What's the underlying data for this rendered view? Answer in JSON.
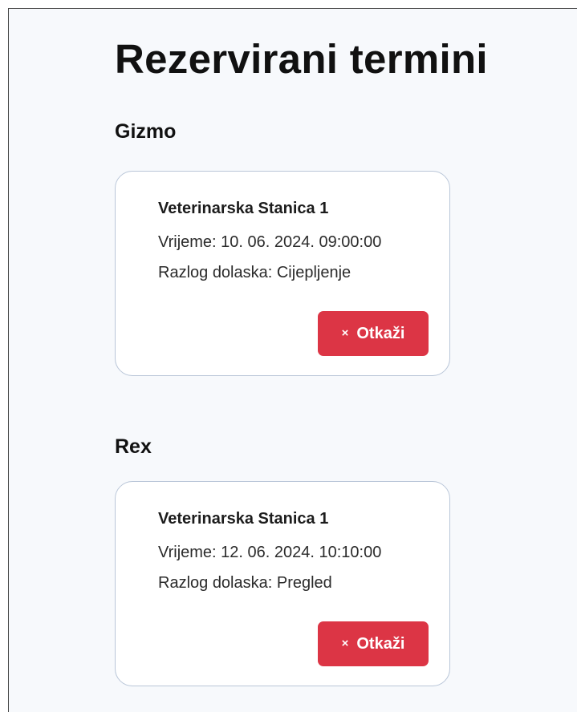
{
  "page": {
    "title": "Rezervirani termini"
  },
  "appointments": [
    {
      "pet_name": "Gizmo",
      "clinic": "Veterinarska Stanica 1",
      "time_label": "Vrijeme: 10. 06. 2024. 09:00:00",
      "reason_label": "Razlog dolaska: Cijepljenje",
      "cancel_icon": "×",
      "cancel_label": "Otkaži"
    },
    {
      "pet_name": "Rex",
      "clinic": "Veterinarska Stanica 1",
      "time_label": "Vrijeme: 12. 06. 2024. 10:10:00",
      "reason_label": "Razlog dolaska: Pregled",
      "cancel_icon": "×",
      "cancel_label": "Otkaži"
    }
  ],
  "colors": {
    "background": "#f7f9fc",
    "card": "#ffffff",
    "card_border": "#b9c6d8",
    "danger": "#dc3545",
    "text": "#111111"
  },
  "icons": {
    "cancel": "close-icon"
  }
}
